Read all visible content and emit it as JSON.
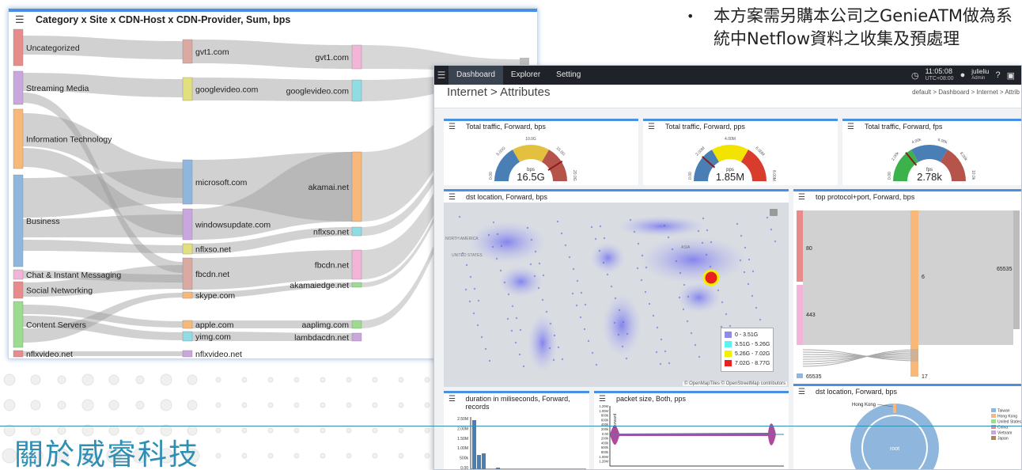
{
  "note": {
    "bullet": "•",
    "text": "本方案需另購本公司之GenieATM做為系統中Netflow資料之收集及預處理"
  },
  "about_title": "關於威睿科技",
  "sankey": {
    "title": "Category x Site x CDN-Host x CDN-Provider, Sum, bps",
    "categories": [
      {
        "label": "Uncategorized",
        "color": "#e88b8b"
      },
      {
        "label": "Streaming Media",
        "color": "#c9a6dd"
      },
      {
        "label": "Information Technology",
        "color": "#f8b87a"
      },
      {
        "label": "Business",
        "color": "#8fb6dc"
      },
      {
        "label": "Chat & Instant Messaging",
        "color": "#f2b5d8"
      },
      {
        "label": "Social Networking",
        "color": "#e88b8b"
      },
      {
        "label": "Content Servers",
        "color": "#9bdc8f"
      },
      {
        "label": "nflxvideo.net",
        "color": "#e88b8b"
      }
    ],
    "sites": [
      {
        "label": "gvt1.com",
        "color": "#d9a9a2"
      },
      {
        "label": "googlevideo.com",
        "color": "#e2e07e"
      },
      {
        "label": "microsoft.com",
        "color": "#8fb6dc"
      },
      {
        "label": "windowsupdate.com",
        "color": "#c9a6dd"
      },
      {
        "label": "nflxso.net",
        "color": "#e2e07e"
      },
      {
        "label": "fbcdn.net",
        "color": "#d9a9a2"
      },
      {
        "label": "skype.com",
        "color": "#f8b87a"
      },
      {
        "label": "apple.com",
        "color": "#f8b87a"
      },
      {
        "label": "yimg.com",
        "color": "#8fdde2"
      },
      {
        "label": "nflxvideo.net",
        "color": "#c9a6dd"
      }
    ],
    "hosts": [
      {
        "label": "gvt1.com",
        "color": "#f2b5d8"
      },
      {
        "label": "googlevideo.com",
        "color": "#8fdde2"
      },
      {
        "label": "akamai.net",
        "color": "#f8b87a"
      },
      {
        "label": "nflxso.net",
        "color": "#8fdde2"
      },
      {
        "label": "fbcdn.net",
        "color": "#f2b5d8"
      },
      {
        "label": "akamaiedge.net",
        "color": "#9bdc8f"
      },
      {
        "label": "aaplimg.com",
        "color": "#9bdc8f"
      },
      {
        "label": "lambdacdn.net",
        "color": "#c9a6dd"
      }
    ]
  },
  "dashboard": {
    "nav": {
      "tabs": [
        "Dashboard",
        "Explorer",
        "Setting"
      ],
      "time": "11:05:08",
      "tz": "UTC+08:00",
      "user": "julieliu",
      "role": "Admin"
    },
    "page_title": "Internet > Attributes",
    "breadcrumb": "default > Dashboard > Internet > Attrib",
    "gauges": [
      {
        "title": "Total traffic, Forward, bps",
        "unit": "bps",
        "value": "16.5G",
        "min": "0.00",
        "max": "20.0G",
        "ticks": [
          "5.00G",
          "10.0G",
          "15.0G"
        ],
        "fraction": 0.82,
        "colors": [
          "#4a7fb5",
          "#e3c040",
          "#b5544a"
        ]
      },
      {
        "title": "Total traffic, Forward, pps",
        "unit": "pps",
        "value": "1.85M",
        "min": "0.00",
        "max": "8.00M",
        "ticks": [
          "2.00M",
          "4.00M",
          "6.00M"
        ],
        "fraction": 0.23,
        "colors": [
          "#4a7fb5",
          "#f2e300",
          "#d93c2c"
        ]
      },
      {
        "title": "Total traffic, Forward, fps",
        "unit": "fps",
        "value": "2.78k",
        "min": "0.00",
        "max": "10.0k",
        "ticks": [
          "2.00k",
          "4.00k",
          "6.00k",
          "8.00k"
        ],
        "fraction": 0.28,
        "colors": [
          "#3cb34a",
          "#4a7fb5",
          "#b5544a"
        ]
      }
    ],
    "map": {
      "title": "dst location, Forward, bps",
      "labels": [
        "NORTH AMERICA",
        "UNITED STATES",
        "ASIA"
      ],
      "legend": [
        {
          "label": "0 - 3.51G",
          "color": "#8d8ce6"
        },
        {
          "label": "3.51G - 5.26G",
          "color": "#5cf2f2"
        },
        {
          "label": "5.26G - 7.02G",
          "color": "#f2f200"
        },
        {
          "label": "7.02G - 8.77G",
          "color": "#e82020"
        }
      ],
      "attribution": "© OpenMapTiles © OpenStreetMap contributors"
    },
    "protocol": {
      "title": "top protocol+port, Forward, bps",
      "labels": [
        "80",
        "443",
        "6",
        "65535",
        "65535",
        "17"
      ]
    },
    "duration": {
      "title": "duration in miliseconds, Forward, records",
      "yticks": [
        "2.50M",
        "2.00M",
        "1.50M",
        "1.00M",
        "500k",
        "0.00"
      ]
    },
    "packet": {
      "title": "packet size, Both, pps",
      "axis_label": "Forward",
      "yticks": [
        "1.20M",
        "1.00M",
        "800k",
        "600k",
        "400k",
        "200k",
        "0.00",
        "200k",
        "400k",
        "600k",
        "800k",
        "1.00M",
        "1.20M"
      ]
    },
    "dstpie": {
      "title": "dst location, Forward, bps",
      "top_label": "Hong Kong",
      "center": "root",
      "legend": [
        {
          "label": "Taiwan",
          "color": "#8fb6dc"
        },
        {
          "label": "Hong Kong",
          "color": "#f8b87a"
        },
        {
          "label": "United States",
          "color": "#9bdc8f"
        },
        {
          "label": "China",
          "color": "#e88b8b"
        },
        {
          "label": "Vietnam",
          "color": "#c9a6dd"
        },
        {
          "label": "Japan",
          "color": "#b5845a"
        }
      ]
    }
  }
}
